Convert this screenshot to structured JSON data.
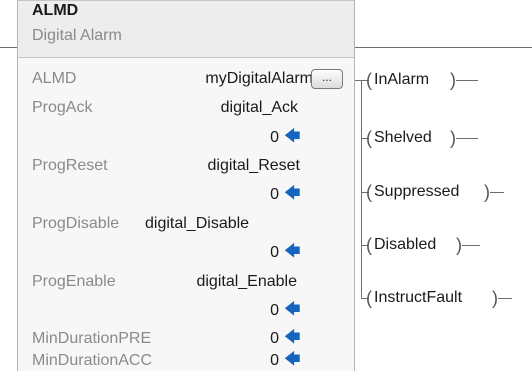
{
  "instruction": {
    "mnemonic": "ALMD",
    "description": "Digital Alarm"
  },
  "operands": [
    {
      "name": "ALMD",
      "tag": "myDigitalAlarm",
      "value": ""
    },
    {
      "name": "ProgAck",
      "tag": "digital_Ack",
      "value": "0"
    },
    {
      "name": "ProgReset",
      "tag": "digital_Reset",
      "value": "0"
    },
    {
      "name": "ProgDisable",
      "tag": "digital_Disable",
      "value": "0"
    },
    {
      "name": "ProgEnable",
      "tag": "digital_Enable",
      "value": "0"
    },
    {
      "name": "MinDurationPRE",
      "tag": "",
      "value": "0"
    },
    {
      "name": "MinDurationACC",
      "tag": "",
      "value": "0"
    }
  ],
  "browse_button": "...",
  "outputs": [
    "InAlarm",
    "Shelved",
    "Suppressed",
    "Disabled",
    "InstructFault"
  ],
  "icons": {
    "value_arrow": "arrow-left-icon"
  },
  "colors": {
    "arrow": "#1565c0",
    "block_bg": "#f7f7f7"
  }
}
